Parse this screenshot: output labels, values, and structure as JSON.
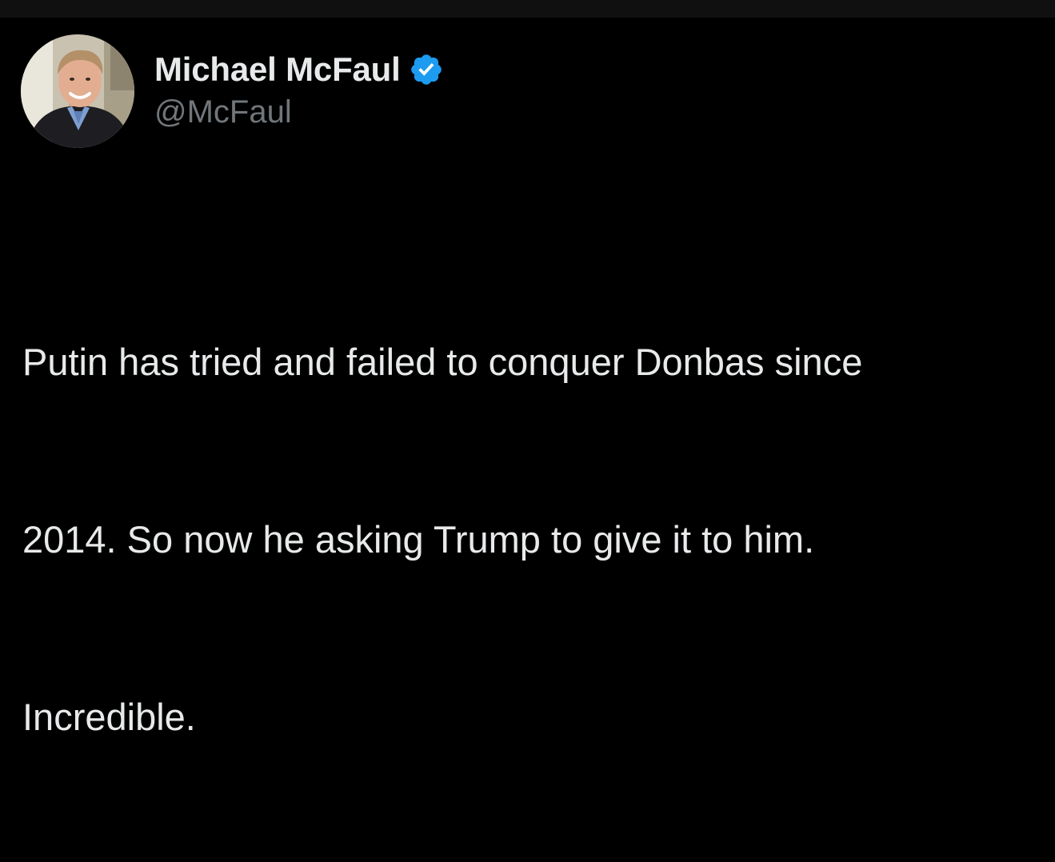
{
  "tweet": {
    "author": {
      "display_name": "Michael McFaul",
      "handle": "@McFaul",
      "verified_icon": "verified-badge-icon",
      "avatar_icon": "profile-photo"
    },
    "text_lines": [
      "Putin has tried and failed to conquer Donbas since",
      "2014. So now he asking Trump to give it to him.",
      "Incredible."
    ]
  },
  "colors": {
    "background": "#000000",
    "top_strip": "#101010",
    "primary_text": "#e7e9ea",
    "secondary_text": "#71767b",
    "verified_blue": "#1d9bf0"
  }
}
